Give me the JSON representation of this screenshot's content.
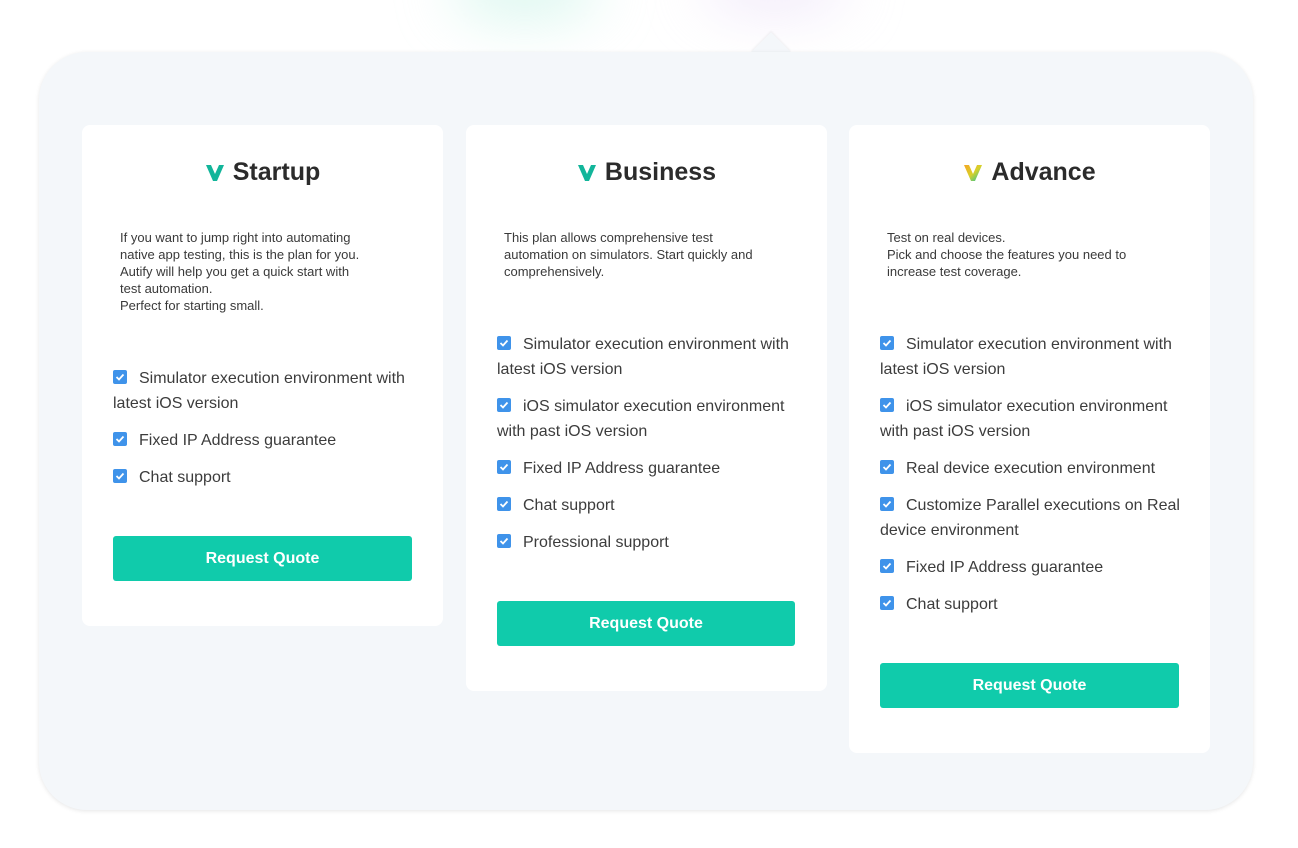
{
  "colors": {
    "accent": "#10cbab",
    "checkbox": "#3f93ea",
    "panel_bg": "#f4f7fa",
    "card_bg": "#ffffff",
    "title_text": "#2b2b2b"
  },
  "plans": [
    {
      "name": "Startup",
      "logo_icon": "check-v-teal-icon",
      "description": "If you want to jump right into automating\nnative app testing, this is the plan for you.\nAutify will help you get a quick start with\ntest automation.\nPerfect for starting small.",
      "features": [
        {
          "label": "Simulator execution environment with latest iOS version",
          "checked": true
        },
        {
          "label": "Fixed IP Address guarantee",
          "checked": true
        },
        {
          "label": "Chat support",
          "checked": true
        }
      ],
      "button_label": "Request Quote"
    },
    {
      "name": "Business",
      "logo_icon": "check-v-teal-icon",
      "description": "This plan allows comprehensive test\nautomation on simulators. Start quickly and\ncomprehensively.",
      "features": [
        {
          "label": "Simulator execution environment with latest iOS version",
          "checked": true
        },
        {
          "label": "iOS simulator execution environment with past iOS version",
          "checked": true
        },
        {
          "label": "Fixed IP Address guarantee",
          "checked": true
        },
        {
          "label": "Chat support",
          "checked": true
        },
        {
          "label": "Professional support",
          "checked": true
        }
      ],
      "button_label": "Request Quote"
    },
    {
      "name": "Advance",
      "logo_icon": "check-v-gradient-icon",
      "description": "Test on real devices.\nPick and choose the features you need to\nincrease test coverage.",
      "features": [
        {
          "label": "Simulator execution environment with latest iOS version",
          "checked": true
        },
        {
          "label": "iOS simulator execution environment with past iOS version",
          "checked": true
        },
        {
          "label": "Real device execution environment",
          "checked": true
        },
        {
          "label": "Customize Parallel executions on Real device environment",
          "checked": true
        },
        {
          "label": "Fixed IP Address guarantee",
          "checked": true
        },
        {
          "label": "Chat support",
          "checked": true
        }
      ],
      "button_label": "Request Quote"
    }
  ]
}
